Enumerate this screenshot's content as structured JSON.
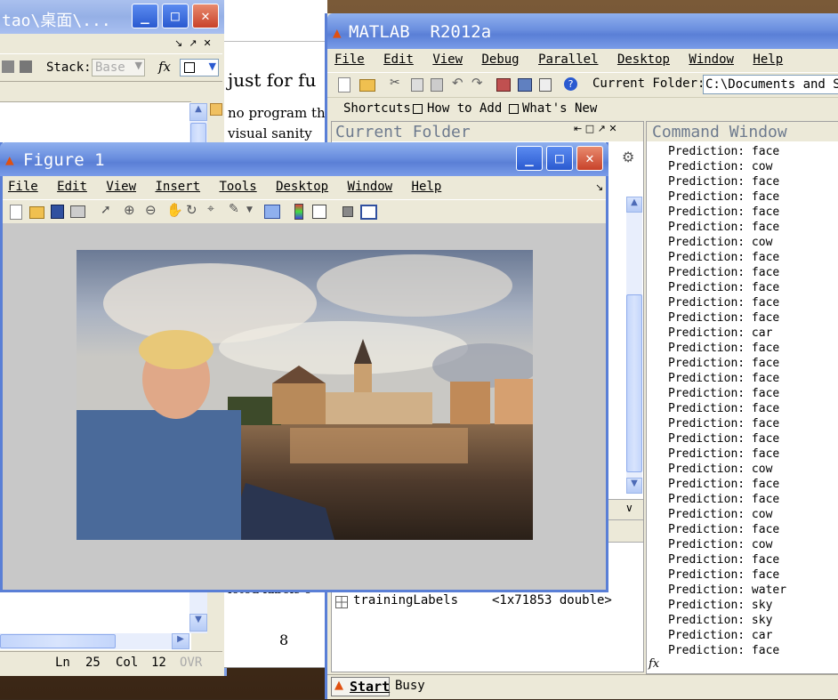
{
  "editor": {
    "title": "tao\\桌面\\...",
    "stack_label": "Stack:",
    "stack_value": "Base",
    "fx": "fx",
    "status_ln_label": "Ln",
    "status_ln": "25",
    "status_col_label": "Col",
    "status_col": "12",
    "status_ovr": "OVR"
  },
  "document": {
    "line1": "just for fu",
    "line2": "no program th",
    "line3": "visual sanity",
    "line4": "icted labels o",
    "page_number": "8"
  },
  "matlab": {
    "title": "MATLAB  R2012a",
    "menu": [
      "File",
      "Edit",
      "View",
      "Debug",
      "Parallel",
      "Desktop",
      "Window",
      "Help"
    ],
    "current_folder_label": "Current Folder:",
    "current_folder_value": "C:\\Documents and Se",
    "shortcuts": "Shortcuts",
    "how_to_add": "How to Add",
    "whats_new": "What's New",
    "current_folder_panel": "Current Folder",
    "command_window_panel": "Command Window",
    "workspace_var_name": "trainingLabels",
    "workspace_var_value": "<1x71853 double>",
    "fx": "fx",
    "start_label": "Start",
    "status": "Busy"
  },
  "command_output": [
    "Prediction: face",
    "Prediction: cow",
    "Prediction: face",
    "Prediction: face",
    "Prediction: face",
    "Prediction: face",
    "Prediction: cow",
    "Prediction: face",
    "Prediction: face",
    "Prediction: face",
    "Prediction: face",
    "Prediction: face",
    "Prediction: car",
    "Prediction: face",
    "Prediction: face",
    "Prediction: face",
    "Prediction: face",
    "Prediction: face",
    "Prediction: face",
    "Prediction: face",
    "Prediction: face",
    "Prediction: cow",
    "Prediction: face",
    "Prediction: face",
    "Prediction: cow",
    "Prediction: face",
    "Prediction: cow",
    "Prediction: face",
    "Prediction: face",
    "Prediction: water",
    "Prediction: sky",
    "Prediction: sky",
    "Prediction: car",
    "Prediction: face"
  ],
  "figure": {
    "title": "Figure 1",
    "menu": [
      "File",
      "Edit",
      "View",
      "Insert",
      "Tools",
      "Desktop",
      "Window",
      "Help"
    ]
  },
  "colors": {
    "xp_blue": "#5a7fd6",
    "panel_title": "#6d7a8e",
    "figure_bg": "#c8c8c8"
  }
}
